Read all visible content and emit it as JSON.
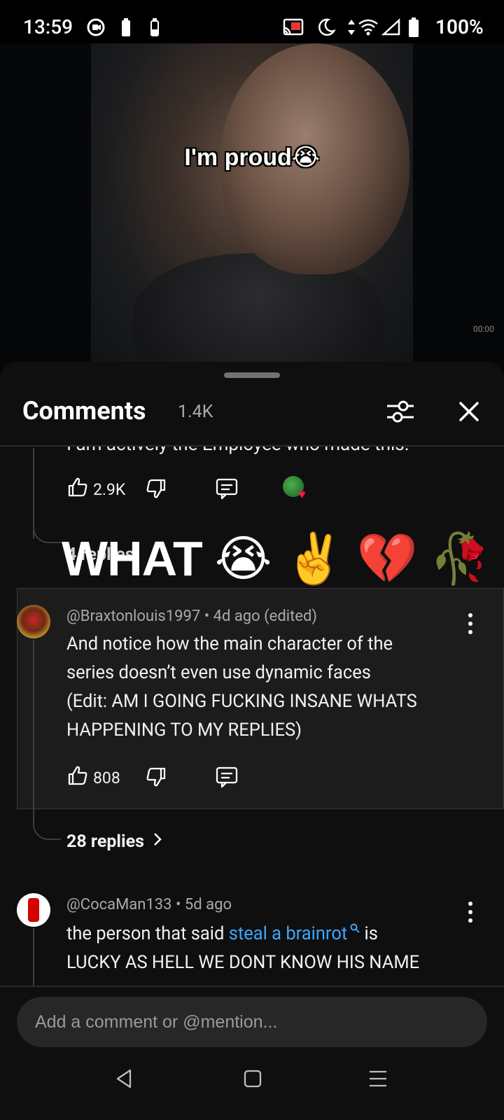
{
  "status_bar": {
    "time": "13:59",
    "battery_pct": "100%",
    "icons": [
      "video-call-icon",
      "battery-small-icon",
      "battery-small-icon",
      "cast-icon",
      "do-not-disturb-icon",
      "data-arrows-icon",
      "wifi-icon",
      "signal-icon",
      "battery-icon"
    ]
  },
  "video": {
    "caption": "I'm proud😭",
    "timecode": "00:00"
  },
  "comments_header": {
    "title": "Comments",
    "count": "1.4K"
  },
  "clipped_comment": {
    "text": "I am actively the Employee who made this.",
    "likes": "2.9K",
    "replies_partial": "4 replies",
    "overlay_text": "WHAT",
    "overlay_emojis": [
      "😭",
      "✌️",
      "💔",
      "🥀"
    ]
  },
  "comments": [
    {
      "author": "@Braxtonlouis1997",
      "age": "4d ago (edited)",
      "text_lines": [
        "And notice how the main character of the",
        "series doesn’t even use dynamic faces",
        "(Edit: AM I GOING FUCKING INSANE WHATS",
        "HAPPENING TO MY REPLIES)"
      ],
      "likes": "808",
      "replies": "28 replies"
    },
    {
      "author": "@CocaMan133",
      "age": "5d ago",
      "text_before": "the person that said ",
      "link_text": "steal a brainrot",
      "text_after": " is",
      "text_line2": "LUCKY AS HELL WE DONT KNOW HIS NAME"
    }
  ],
  "comment_input": {
    "placeholder": "Add a comment or @mention..."
  },
  "colors": {
    "sheet_bg": "#0f0f0f",
    "highlight_bg": "#1c1c1c",
    "link": "#3ea6ff",
    "secondary_text": "#aaaaaa"
  }
}
